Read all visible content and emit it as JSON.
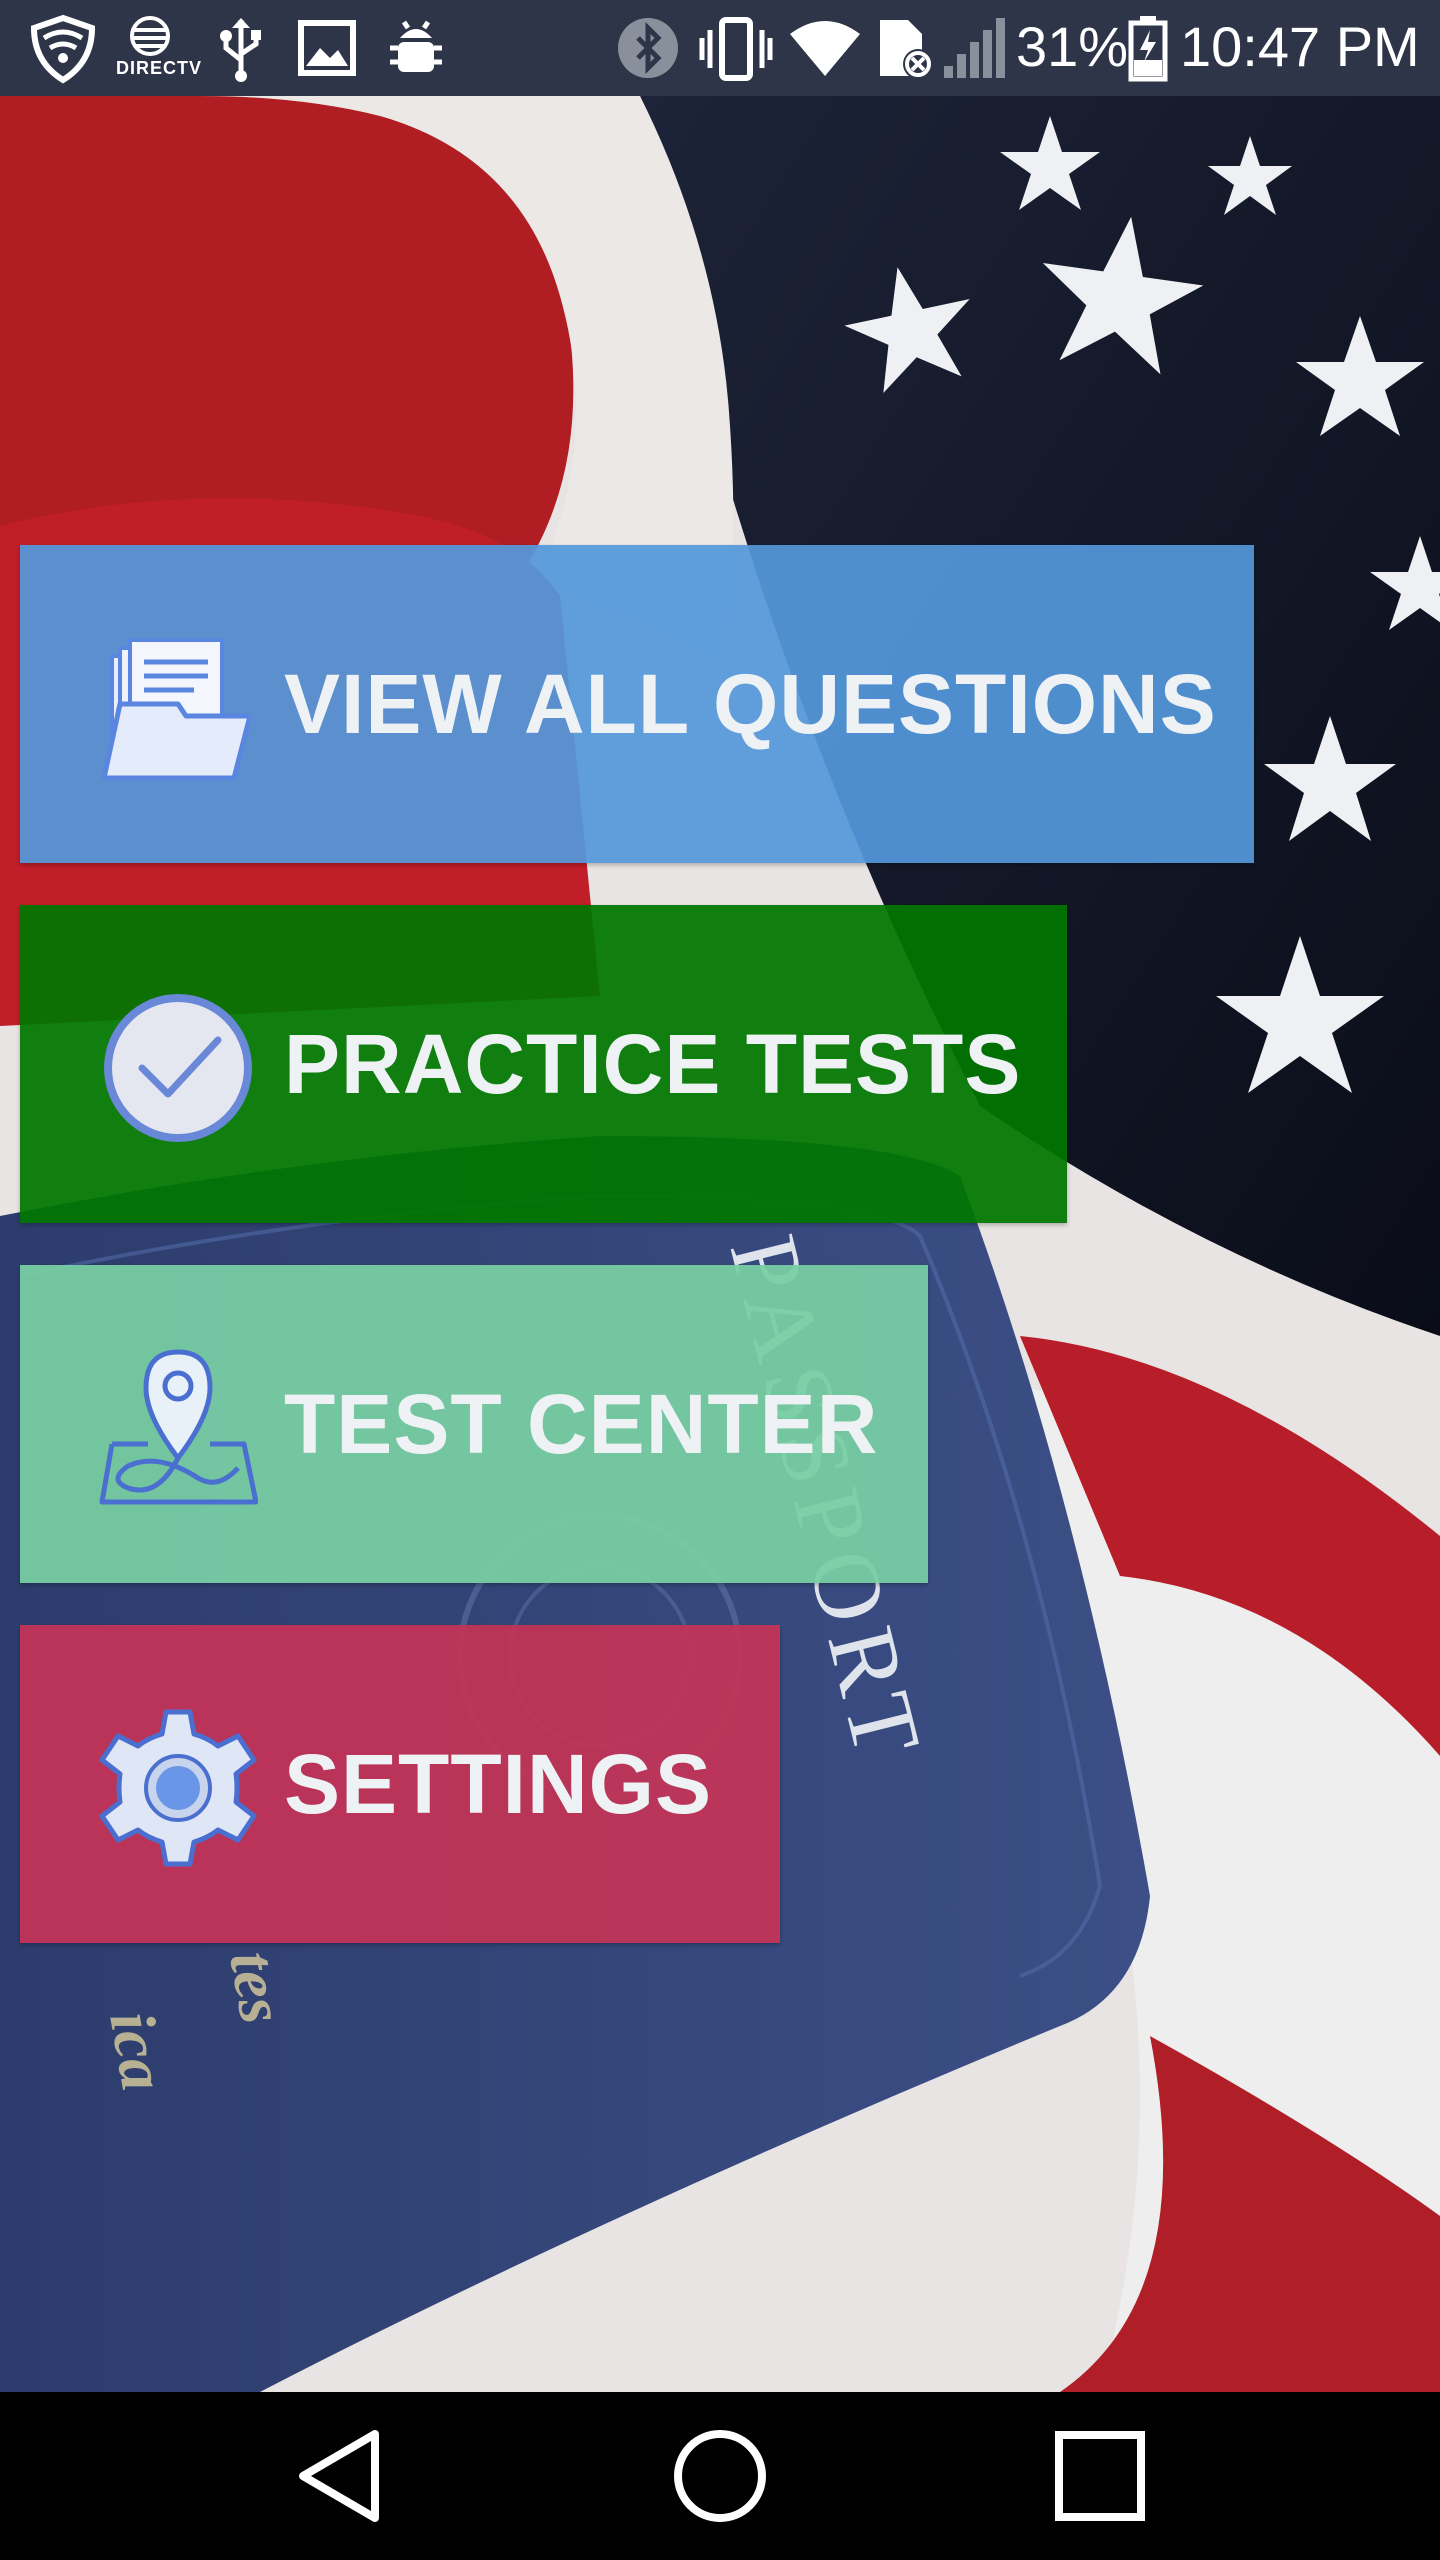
{
  "status_bar": {
    "battery": "31%",
    "time": "10:47 PM",
    "carrier_label": "DIRECTV",
    "icons": [
      "security-shield-icon",
      "directv-icon",
      "usb-icon",
      "image-icon",
      "android-debug-icon",
      "bluetooth-icon",
      "vibrate-icon",
      "wifi-icon",
      "sim-error-icon",
      "signal-icon",
      "battery-icon"
    ]
  },
  "menu": {
    "items": [
      {
        "label": "VIEW ALL QUESTIONS",
        "icon": "documents-folder-icon",
        "color": "#5498da"
      },
      {
        "label": "PRACTICE TESTS",
        "icon": "checkmark-circle-icon",
        "color": "#007600"
      },
      {
        "label": "TEST CENTER",
        "icon": "map-pin-icon",
        "color": "#78cea4"
      },
      {
        "label": "SETTINGS",
        "icon": "gear-icon",
        "color": "#c43456"
      }
    ]
  },
  "background": {
    "passport_text": "PASSPORT",
    "cover_text_1": "ica",
    "cover_text_2": "tes"
  },
  "nav_bar": {
    "icons": [
      "back-icon",
      "home-icon",
      "recents-icon"
    ]
  }
}
